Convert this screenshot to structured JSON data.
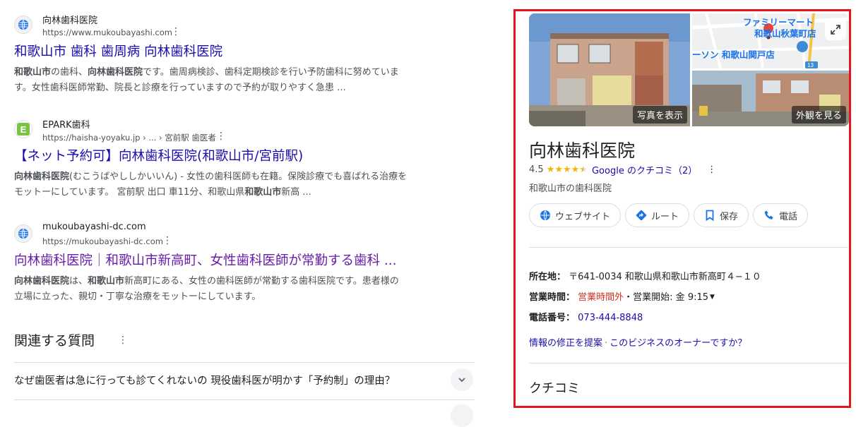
{
  "results": [
    {
      "site_name": "向林歯科医院",
      "url": "https://www.mukoubayashi.com",
      "title": "和歌山市 歯科 歯周病 向林歯科医院",
      "snippet_line1": [
        {
          "b": "和歌山市"
        },
        {
          "t": "の歯科、"
        },
        {
          "b": "向林歯科医院"
        },
        {
          "t": "です。歯周病検診、歯科定期検診を行い予防歯科に努めていま"
        }
      ],
      "snippet_line2": [
        {
          "t": "す。女性歯科医師常勤、院長と診療を行っていますので予約が取りやすく急患 ..."
        }
      ],
      "favicon_icon": "globe-icon"
    },
    {
      "site_name": "EPARK歯科",
      "url": "https://haisha-yoyaku.jp › ... › 宮前駅 歯医者",
      "title": "【ネット予約可】向林歯科医院(和歌山市/宮前駅)",
      "snippet_line1": [
        {
          "b": "向林歯科医院"
        },
        {
          "t": "(むこうばやししかいいん) - 女性の歯科医師も在籍。保険診療でも喜ばれる治療を"
        }
      ],
      "snippet_line2": [
        {
          "t": "モットーにしています。 宮前駅 出口 車11分、和歌山県"
        },
        {
          "b": "和歌山市"
        },
        {
          "t": "新高 ..."
        }
      ],
      "favicon_icon": "epark-e-icon"
    },
    {
      "site_name": "mukoubayashi-dc.com",
      "url": "https://mukoubayashi-dc.com",
      "title": "向林歯科医院｜和歌山市新高町、女性歯科医師が常勤する歯科 ...",
      "snippet_line1": [
        {
          "b": "向林歯科医院"
        },
        {
          "t": "は、"
        },
        {
          "b": "和歌山市"
        },
        {
          "t": "新高町にある、女性の歯科医師が常勤する歯科医院です。患者様の"
        }
      ],
      "snippet_line2": [
        {
          "t": "立場に立った、親切・丁寧な治療をモットーにしています。"
        }
      ],
      "favicon_icon": "globe-icon"
    }
  ],
  "related_questions": {
    "title": "関連する質問",
    "items": [
      "なぜ歯医者は急に行っても診てくれないの 現役歯科医が明かす「予約制」の理由？"
    ]
  },
  "panel": {
    "photo_label": "写真を表示",
    "exterior_label": "外観を見る",
    "map_labels": {
      "store1": "ファミリーマート",
      "store2": "和歌山秋葉町店",
      "store3": "ーソン 和歌山関戸店",
      "road": "13"
    },
    "name": "向林歯科医院",
    "rating": "4.5",
    "stars_filled": 4.5,
    "review_link": "Google のクチコミ（2）",
    "category": "和歌山市の歯科医院",
    "actions": {
      "website": "ウェブサイト",
      "route": "ルート",
      "save": "保存",
      "call": "電話"
    },
    "address_label": "所在地：",
    "address": "〒641-0034 和歌山県和歌山市新高町４−１０",
    "hours_label": "営業時間：",
    "hours_status": "営業時間外",
    "hours_detail": "・営業開始: 金 9:15",
    "phone_label": "電話番号：",
    "phone": "073-444-8848",
    "suggest_edit": "情報の修正を提案",
    "owner_question": "このビジネスのオーナーですか？",
    "link_separator": "·",
    "reviews_heading": "クチコミ"
  }
}
